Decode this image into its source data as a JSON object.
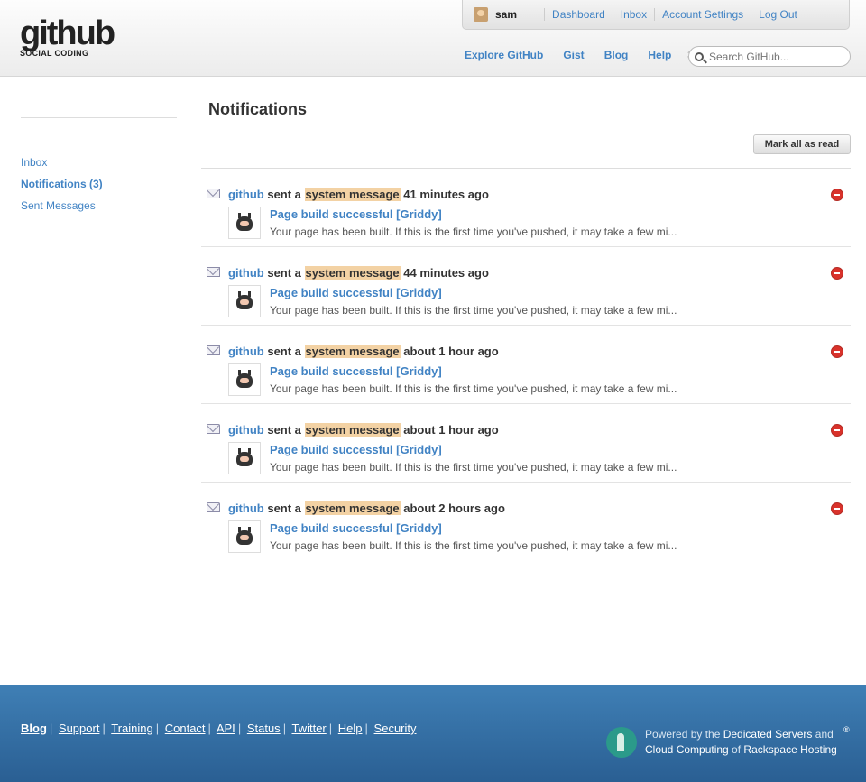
{
  "header": {
    "logo_word": "github",
    "logo_sub": "SOCIAL CODING",
    "username": "sam",
    "user_links": [
      "Dashboard",
      "Inbox",
      "Account Settings",
      "Log Out"
    ],
    "nav": [
      "Explore GitHub",
      "Gist",
      "Blog",
      "Help"
    ],
    "search_placeholder": "Search GitHub..."
  },
  "sidebar": {
    "items": [
      {
        "label": "Inbox"
      },
      {
        "label": "Notifications (3)"
      },
      {
        "label": "Sent Messages"
      }
    ]
  },
  "main": {
    "title": "Notifications",
    "mark_all_label": "Mark all as read",
    "messages": [
      {
        "from": "github",
        "sent_text": "sent a",
        "type": "system message",
        "time": "41 minutes ago",
        "subject": "Page build successful [Griddy]",
        "body": "Your page has been built. If this is the first time you've pushed, it may take a few mi...",
        "read": false
      },
      {
        "from": "github",
        "sent_text": "sent a",
        "type": "system message",
        "time": "44 minutes ago",
        "subject": "Page build successful [Griddy]",
        "body": "Your page has been built. If this is the first time you've pushed, it may take a few mi...",
        "read": false
      },
      {
        "from": "github",
        "sent_text": "sent a",
        "type": "system message",
        "time": "about 1 hour ago",
        "subject": "Page build successful [Griddy]",
        "body": "Your page has been built. If this is the first time you've pushed, it may take a few mi...",
        "read": false
      },
      {
        "from": "github",
        "sent_text": "sent a",
        "type": "system message",
        "time": "about 1 hour ago",
        "subject": "Page build successful [Griddy]",
        "body": "Your page has been built. If this is the first time you've pushed, it may take a few mi...",
        "read": true
      },
      {
        "from": "github",
        "sent_text": "sent a",
        "type": "system message",
        "time": "about 2 hours ago",
        "subject": "Page build successful [Griddy]",
        "body": "Your page has been built. If this is the first time you've pushed, it may take a few mi...",
        "read": true
      }
    ]
  },
  "footer": {
    "links": [
      "Blog",
      "Support",
      "Training",
      "Contact",
      "API",
      "Status",
      "Twitter",
      "Help",
      "Security"
    ],
    "hosting_line1_a": "Powered by the ",
    "hosting_line1_b": "Dedicated Servers",
    "hosting_line1_c": " and",
    "hosting_line2_a": "Cloud Computing",
    "hosting_line2_b": " of ",
    "hosting_line2_c": "Rackspace Hosting",
    "reg_mark": "®"
  }
}
